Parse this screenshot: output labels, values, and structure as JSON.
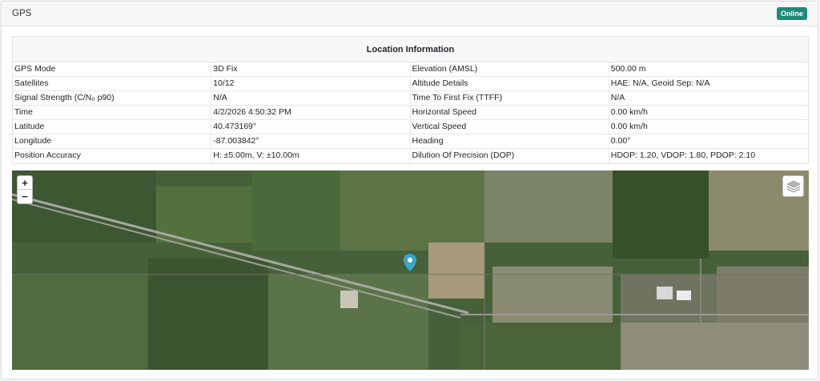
{
  "header": {
    "title": "GPS",
    "status": "Online"
  },
  "location": {
    "heading": "Location Information",
    "rows": [
      [
        "GPS Mode",
        "3D Fix",
        "Elevation (AMSL)",
        "500.00 m"
      ],
      [
        "Satellites",
        "10/12",
        "Altitude Details",
        "HAE: N/A, Geoid Sep: N/A"
      ],
      [
        "Signal Strength (C/N₀ p90)",
        "N/A",
        "Time To First Fix (TTFF)",
        "N/A"
      ],
      [
        "Time",
        "4/2/2026 4:50:32 PM",
        "Horizontal Speed",
        "0.00 km/h"
      ],
      [
        "Latitude",
        "40.473169°",
        "Vertical Speed",
        "0.00 km/h"
      ],
      [
        "Longitude",
        "-87.003842°",
        "Heading",
        "0.00°"
      ],
      [
        "Position Accuracy",
        "H: ±5.00m, V: ±10.00m",
        "Dilution Of Precision (DOP)",
        "HDOP: 1.20, VDOP: 1.80, PDOP: 2.10"
      ]
    ]
  },
  "map": {
    "zoom_in": "+",
    "zoom_out": "−",
    "layers_icon": "layers-icon",
    "marker_icon": "map-pin-icon",
    "marker_color": "#3aa6c8"
  },
  "colors": {
    "badge": "#1e8a7a"
  }
}
